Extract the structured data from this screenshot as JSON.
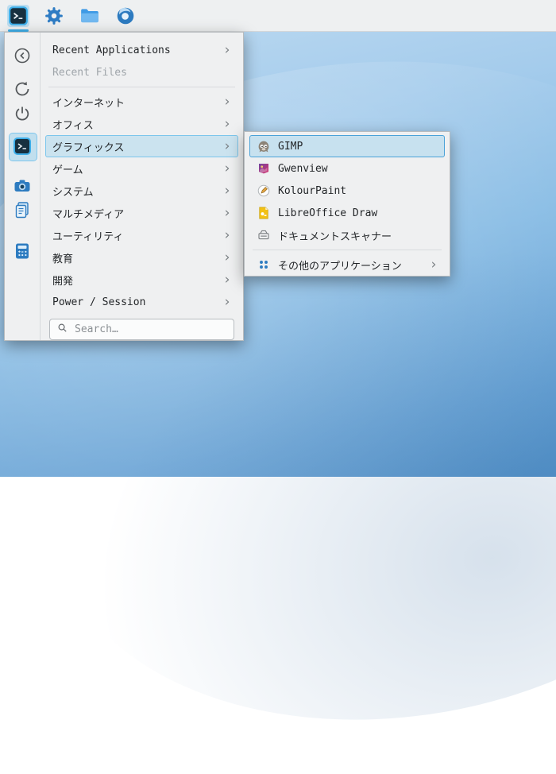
{
  "colors": {
    "accent": "#3daee9",
    "panel_bg": "#eff0f1",
    "menu_bg": "#eff0f1",
    "text": "#232629",
    "disabled_text": "#9fa5aa"
  },
  "panel": {
    "apps": [
      {
        "icon": "konsole-icon",
        "active": true
      },
      {
        "icon": "system-settings-icon",
        "active": false
      },
      {
        "icon": "file-manager-icon",
        "active": false
      },
      {
        "icon": "web-browser-icon",
        "active": false
      }
    ]
  },
  "launcher": {
    "sidebar_icons": [
      "back-icon",
      "refresh-icon",
      "power-icon",
      "konsole-favorite-icon",
      "screenshot-icon",
      "documents-icon",
      "calculator-icon"
    ],
    "top_items": [
      {
        "label": "Recent Applications",
        "enabled": true
      },
      {
        "label": "Recent Files",
        "enabled": false
      }
    ],
    "categories": [
      "インターネット",
      "オフィス",
      "グラフィックス",
      "ゲーム",
      "システム",
      "マルチメディア",
      "ユーティリティ",
      "教育",
      "開発",
      "Power / Session"
    ],
    "selected_category": "グラフィックス",
    "search_placeholder": "Search…"
  },
  "submenu": {
    "apps": [
      {
        "label": "GIMP",
        "selected": true
      },
      {
        "label": "Gwenview",
        "selected": false
      },
      {
        "label": "KolourPaint",
        "selected": false
      },
      {
        "label": "LibreOffice Draw",
        "selected": false
      },
      {
        "label": "ドキュメントスキャナー",
        "selected": false
      }
    ],
    "more_label": "その他のアプリケーション"
  }
}
